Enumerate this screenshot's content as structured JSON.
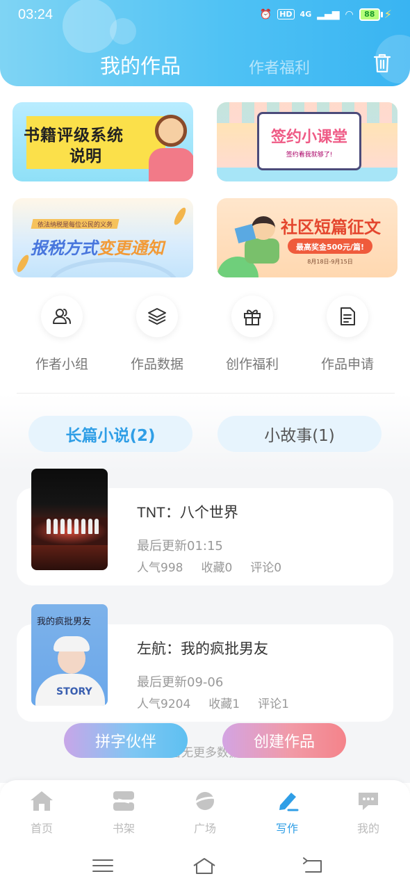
{
  "status_bar": {
    "time": "03:24",
    "network": "4G",
    "hd": "HD",
    "battery": "88"
  },
  "header": {
    "tab_active": "我的作品",
    "tab_inactive": "作者福利"
  },
  "banners": [
    {
      "line1": "书籍评级系统",
      "line2": "说明"
    },
    {
      "line1": "签约小课堂",
      "line2": "签约看我就够了!"
    },
    {
      "tag": "依法纳税是每位公民的义务",
      "line1_a": "报税方式",
      "line1_b": "变更通知"
    },
    {
      "line1": "社区短篇征文",
      "line2": "最高奖金500元/篇!",
      "line3": "8月18日-9月15日"
    }
  ],
  "quick_actions": [
    {
      "label": "作者小组",
      "icon": "people-icon"
    },
    {
      "label": "作品数据",
      "icon": "layers-icon"
    },
    {
      "label": "创作福利",
      "icon": "gift-icon"
    },
    {
      "label": "作品申请",
      "icon": "document-icon"
    }
  ],
  "segments": {
    "long_novel": "长篇小说(2)",
    "short_story": "小故事(1)"
  },
  "works": [
    {
      "title": "TNT：八个世界",
      "updated": "最后更新01:15",
      "popularity": "人气998",
      "favorites": "收藏0",
      "comments": "评论0"
    },
    {
      "title": "左航：我的疯批男友",
      "cover_text": "我的疯批男友",
      "cover_shirt": "STORY",
      "updated": "最后更新09-06",
      "popularity": "人气9204",
      "favorites": "收藏1",
      "comments": "评论1"
    }
  ],
  "list_footer": "暂无更多数据",
  "floating_buttons": {
    "partner": "拼字伙伴",
    "create": "创建作品"
  },
  "tabbar": [
    {
      "label": "首页",
      "icon": "home-icon"
    },
    {
      "label": "书架",
      "icon": "bookshelf-icon"
    },
    {
      "label": "广场",
      "icon": "planet-icon"
    },
    {
      "label": "写作",
      "icon": "pen-icon",
      "active": true
    },
    {
      "label": "我的",
      "icon": "chat-bubble-icon"
    }
  ],
  "colors": {
    "accent": "#2f9ee6",
    "header_blue": "#4fc2f4",
    "create_pink": "#f4838a"
  }
}
